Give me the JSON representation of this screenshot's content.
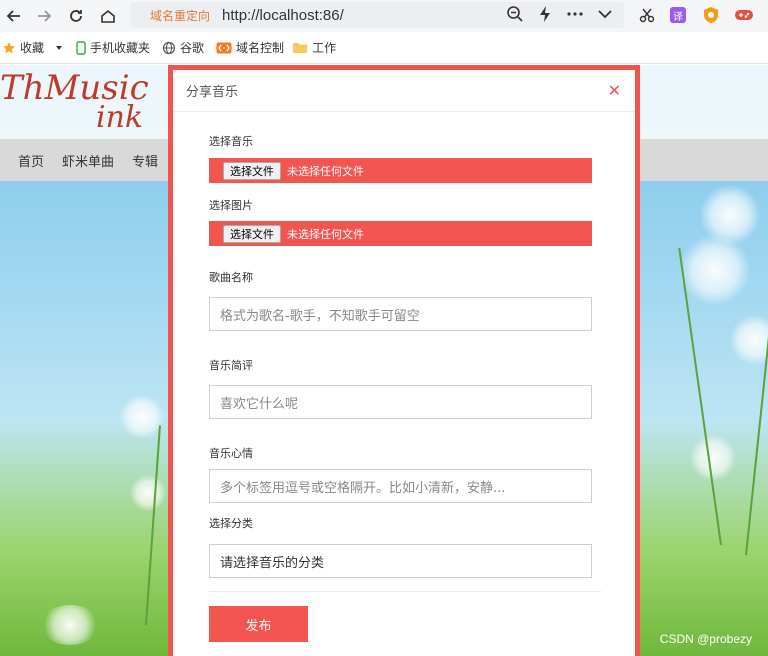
{
  "browser": {
    "redirect_label": "域名重定向",
    "url": "http://localhost:86/",
    "bookmarks": [
      {
        "label": "收藏",
        "icon": "star-icon"
      },
      {
        "label": "手机收藏夹",
        "icon": "phone-icon"
      },
      {
        "label": "谷歌",
        "icon": "globe-icon"
      },
      {
        "label": "域名控制",
        "icon": "bracket-icon"
      },
      {
        "label": "工作",
        "icon": "folder-icon"
      }
    ],
    "extensions": [
      {
        "icon": "scissors-icon",
        "color": "#333333"
      },
      {
        "icon": "translate-icon",
        "label": "译",
        "color": "#9b59f5"
      },
      {
        "icon": "shield-extension-icon",
        "color": "#f39c12"
      },
      {
        "icon": "gamepad-extension-icon",
        "color": "#e74c3c"
      }
    ]
  },
  "site": {
    "logo_line1": "ThMusic",
    "logo_line2": "ink",
    "nav": [
      "首页",
      "虾米单曲",
      "专辑"
    ]
  },
  "modal": {
    "title": "分享音乐",
    "music_label": "选择音乐",
    "image_label": "选择图片",
    "file_button": "选择文件",
    "file_status": "未选择任何文件",
    "song_label": "歌曲名称",
    "song_placeholder": "格式为歌名-歌手，不知歌手可留空",
    "review_label": "音乐简评",
    "review_placeholder": "喜欢它什么呢",
    "mood_label": "音乐心情",
    "mood_placeholder": "多个标签用逗号或空格隔开。比如小清新，安静...",
    "category_label": "选择分类",
    "category_value": "请选择音乐的分类",
    "submit_label": "发布"
  },
  "watermark": "CSDN @probezy",
  "colors": {
    "accent": "#f25450",
    "redirect": "#e57a2e"
  }
}
